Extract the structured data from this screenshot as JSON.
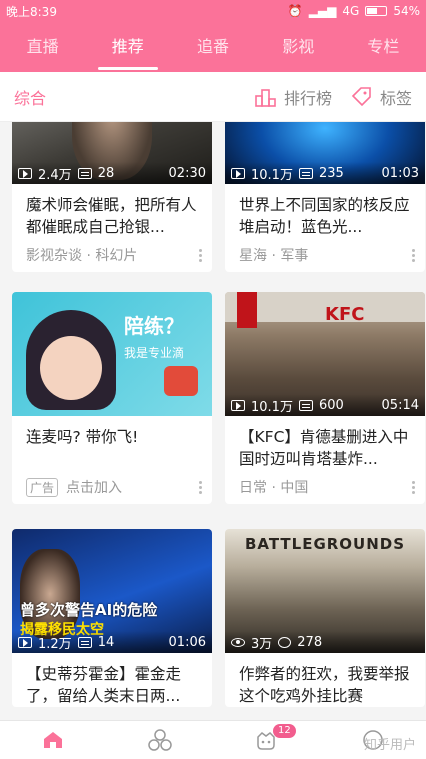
{
  "status": {
    "time": "晚上8:39",
    "network": "4G",
    "battery": "54%",
    "battery_level": 0.54
  },
  "topnav": {
    "tabs": [
      "直播",
      "推荐",
      "追番",
      "影视",
      "专栏"
    ],
    "active": 1
  },
  "subbar": {
    "title": "综合",
    "rank_label": "排行榜",
    "tag_label": "标签"
  },
  "cards": [
    {
      "views": "2.4万",
      "danmaku": "28",
      "duration": "02:30",
      "title": "魔术师会催眠，把所有人都催眠成自己抢银...",
      "meta": "影视杂谈 · 科幻片"
    },
    {
      "views": "10.1万",
      "danmaku": "235",
      "duration": "01:03",
      "title": "世界上不同国家的核反应堆启动！蓝色光...",
      "meta": "星海 · 军事"
    },
    {
      "title": "连麦吗? 带你飞!",
      "ad_tag": "广告",
      "meta": "点击加入",
      "thumb_text": "陪练？",
      "thumb_sub": "我是专业滴"
    },
    {
      "views": "10.1万",
      "danmaku": "600",
      "duration": "05:14",
      "title": "【KFC】肯德基删进入中国时迈叫肯塔基炸...",
      "meta": "日常 · 中国",
      "thumb_text": "KFC"
    },
    {
      "views": "1.2万",
      "danmaku": "14",
      "duration": "01:06",
      "title": "【史蒂芬霍金】霍金走了，留给人类末日两...",
      "thumb_text": "曾多次警告AI的危险",
      "thumb_sub": "揭露移民太空"
    },
    {
      "views": "3万",
      "danmaku": "278",
      "title": "作弊者的狂欢，我要举报这个吃鸡外挂比赛",
      "thumb_text": "BATTLEGROUNDS"
    }
  ],
  "bottomnav": {
    "badge": "12",
    "watermark": "知乎用户"
  }
}
